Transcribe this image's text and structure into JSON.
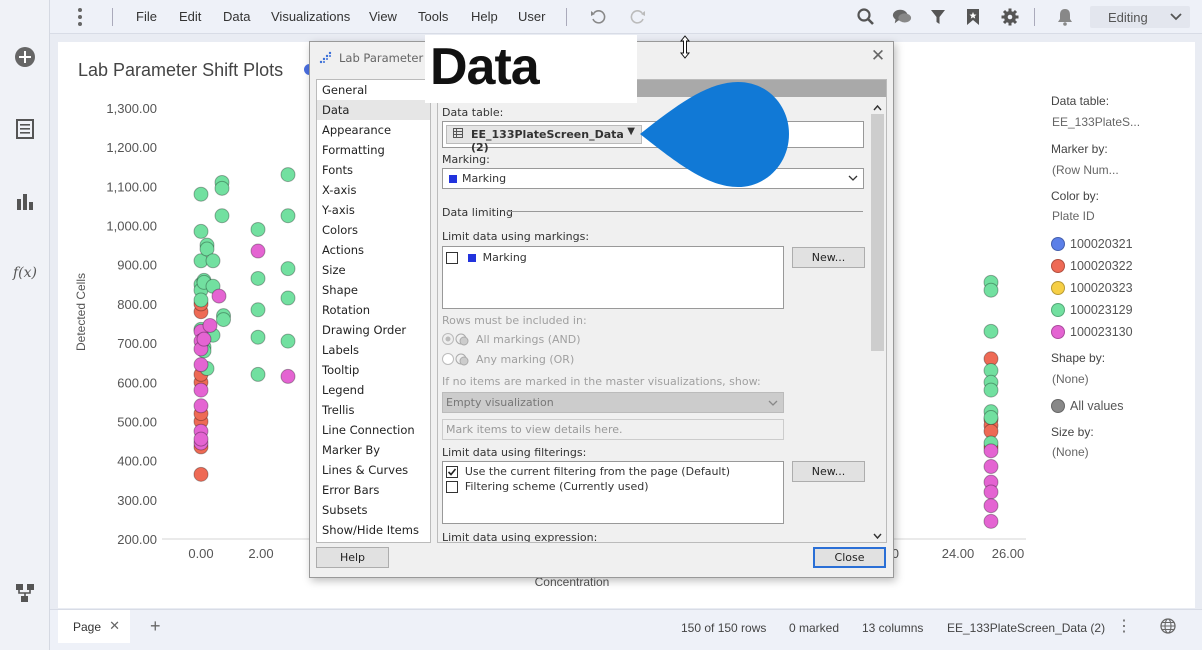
{
  "menubar": {
    "items": [
      "File",
      "Edit",
      "Data",
      "Visualizations",
      "View",
      "Tools",
      "Help",
      "User"
    ],
    "mode": "Editing"
  },
  "leftrail": {
    "icons": [
      "add-circle-icon",
      "data-table-icon",
      "bar-chart-icon",
      "function-icon",
      "hierarchy-icon"
    ],
    "fx_label": "f(x)"
  },
  "visualization": {
    "title": "Lab Parameter Shift Plots",
    "xlabel": "Concentration",
    "ylabel": "Detected Cells"
  },
  "chart_data": {
    "type": "scatter",
    "title": "Lab Parameter Shift Plots",
    "xlabel": "Concentration",
    "ylabel": "Detected Cells",
    "y_ticks": [
      "1,300.00",
      "1,200.00",
      "1,100.00",
      "1,000.00",
      "900.00",
      "800.00",
      "700.00",
      "600.00",
      "500.00",
      "400.00",
      "300.00",
      "200.00"
    ],
    "x_ticks_visible": [
      "0.00",
      "2.00",
      ".00",
      "24.00",
      "26.00"
    ],
    "ylim": [
      200,
      1300
    ],
    "xlim": [
      -1,
      26.5
    ],
    "series": [
      {
        "name": "100020321",
        "color": "#5b7fe8",
        "x": [],
        "y": []
      },
      {
        "name": "100020322",
        "color": "#ee6a55",
        "x": [
          0,
          0,
          0,
          0,
          0,
          0,
          0,
          0,
          25.3,
          25.3,
          25.3,
          25.3,
          25.3
        ],
        "y": [
          365,
          435,
          500,
          520,
          600,
          620,
          780,
          800,
          660,
          505,
          490,
          475,
          435
        ]
      },
      {
        "name": "100020323",
        "color": "#f6cf45",
        "x": [],
        "y": []
      },
      {
        "name": "100023129",
        "color": "#72e0a0",
        "x": [
          0,
          0,
          0,
          0,
          0,
          0,
          0,
          0.1,
          0.1,
          0.1,
          0.1,
          0.1,
          0.2,
          0.2,
          0.2,
          0.4,
          0.4,
          0.4,
          0.7,
          0.7,
          0.7,
          0.75,
          0.75,
          1.9,
          1.9,
          1.9,
          1.9,
          1.9,
          2.9,
          2.9,
          2.9,
          2.9,
          2.9,
          25.3,
          25.3,
          25.3,
          25.3,
          25.3,
          25.3,
          25.3,
          25.3,
          25.3
        ],
        "y": [
          1080,
          985,
          910,
          850,
          835,
          810,
          735,
          720,
          690,
          680,
          860,
          855,
          950,
          940,
          635,
          910,
          845,
          720,
          1025,
          1110,
          1095,
          770,
          760,
          990,
          865,
          785,
          715,
          620,
          1130,
          1025,
          890,
          815,
          705,
          855,
          835,
          730,
          630,
          600,
          580,
          525,
          510,
          445
        ]
      },
      {
        "name": "100023130",
        "color": "#e464d2",
        "x": [
          0,
          0,
          0,
          0,
          0,
          0,
          0,
          0,
          0,
          0.1,
          0.3,
          0.6,
          1.9,
          2.9,
          25.3,
          25.3,
          25.3,
          25.3,
          25.3,
          25.3
        ],
        "y": [
          730,
          705,
          645,
          580,
          475,
          445,
          455,
          685,
          540,
          710,
          745,
          820,
          935,
          615,
          425,
          385,
          345,
          320,
          285,
          245
        ]
      }
    ]
  },
  "legend": {
    "data_table_label": "Data table:",
    "data_table_value": "EE_133PlateS...",
    "marker_by_label": "Marker by:",
    "marker_by_value": "(Row Num...",
    "color_by_label": "Color by:",
    "color_by_value": "Plate ID",
    "colors": [
      {
        "label": "100020321",
        "color": "#5b7fe8"
      },
      {
        "label": "100020322",
        "color": "#ee6a55"
      },
      {
        "label": "100020323",
        "color": "#f6cf45"
      },
      {
        "label": "100023129",
        "color": "#72e0a0"
      },
      {
        "label": "100023130",
        "color": "#e464d2"
      }
    ],
    "shape_by_label": "Shape by:",
    "shape_by_value": "(None)",
    "all_values_label": "All values",
    "size_by_label": "Size by:",
    "size_by_value": "(None)"
  },
  "dialog": {
    "title": "Lab Parameter Sh",
    "sections": [
      "General",
      "Data",
      "Appearance",
      "Formatting",
      "Fonts",
      "X-axis",
      "Y-axis",
      "Colors",
      "Actions",
      "Size",
      "Shape",
      "Rotation",
      "Drawing Order",
      "Labels",
      "Tooltip",
      "Legend",
      "Trellis",
      "Line Connection",
      "Marker By",
      "Lines & Curves",
      "Error Bars",
      "Subsets",
      "Show/Hide Items"
    ],
    "selected_section": "Data",
    "data_table_label": "Data table:",
    "data_table_value": "EE_133PlateScreen_Data (2)",
    "marking_label": "Marking:",
    "marking_value": "Marking",
    "data_limiting_label": "Data limiting",
    "limit_markings_label": "Limit data using markings:",
    "limit_markings_item": "Marking",
    "new_button": "New...",
    "rows_included_label": "Rows must be included in:",
    "all_markings_label": "All markings (AND)",
    "any_marking_label": "Any marking (OR)",
    "if_no_items_label": "If no items are marked in the master visualizations, show:",
    "empty_viz_value": "Empty visualization",
    "mark_items_placeholder": "Mark items to view details here.",
    "limit_filterings_label": "Limit data using filterings:",
    "filter_item_1": "Use the current filtering from the page (Default)",
    "filter_item_2": "Filtering scheme (Currently used)",
    "limit_expression_label": "Limit data using expression:",
    "help_button": "Help",
    "close_button": "Close"
  },
  "callout": {
    "text": "Data"
  },
  "statusbar": {
    "page_tab": "Page",
    "rows": "150 of 150 rows",
    "marked": "0 marked",
    "columns": "13 columns",
    "table": "EE_133PlateScreen_Data (2)"
  }
}
